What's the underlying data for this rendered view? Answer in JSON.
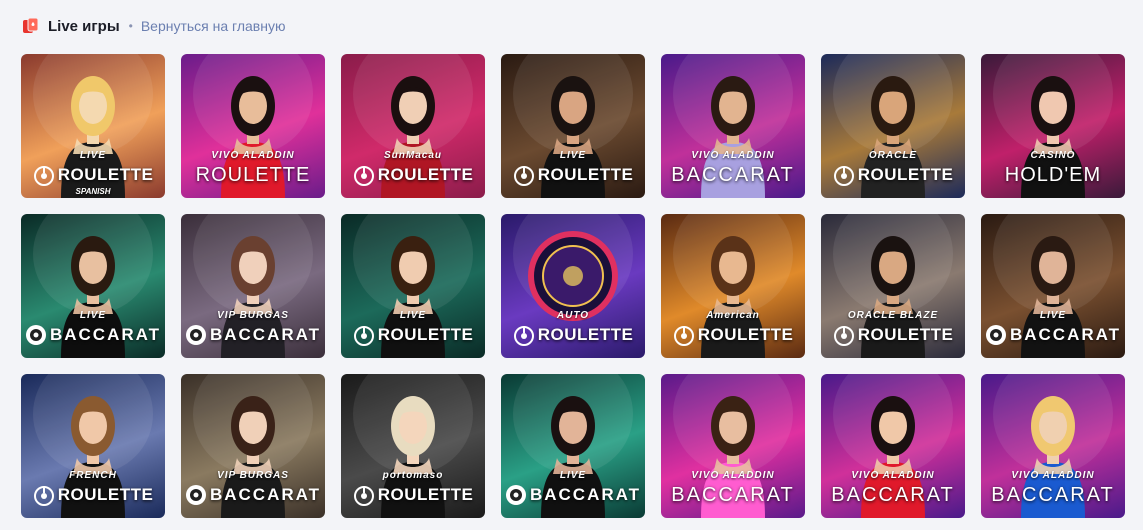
{
  "header": {
    "title": "Live игры",
    "separator": "•",
    "back_link": "Вернуться на главную",
    "icon": "cards-icon",
    "accent": "#e8342e"
  },
  "games": [
    {
      "tag": "LIVE",
      "name": "ROULETTE",
      "sub": "SPANISH",
      "chip": "roulette",
      "bg": [
        "#8a3a2e",
        "#f0a05a"
      ],
      "skin": "#f4d9b0",
      "hair": "#f0c86a",
      "outfit": "#1a1a1a"
    },
    {
      "tag": "VIVO ALADDIN",
      "name": "ROULETTE",
      "sub": "",
      "chip": "none",
      "bg": [
        "#6a1c8a",
        "#e0309a"
      ],
      "skin": "#e8bd9a",
      "hair": "#1a1010",
      "outfit": "#e0192b"
    },
    {
      "tag": "SunMacau",
      "name": "ROULETTE",
      "sub": "",
      "chip": "roulette",
      "bg": [
        "#8a1c4a",
        "#d02a6a"
      ],
      "skin": "#f0cfb5",
      "hair": "#1a0f0f",
      "outfit": "#b01624"
    },
    {
      "tag": "LIVE",
      "name": "ROULETTE",
      "sub": "",
      "chip": "roulette",
      "bg": [
        "#2a1a12",
        "#6b4a30"
      ],
      "skin": "#d9a582",
      "hair": "#1a1210",
      "outfit": "#111111"
    },
    {
      "tag": "VIVO ALADDIN",
      "name": "BACCARAT",
      "sub": "",
      "chip": "none",
      "bg": [
        "#4a1a8a",
        "#c0309a"
      ],
      "skin": "#e2b490",
      "hair": "#2a1a12",
      "outfit": "#a8a0e0"
    },
    {
      "tag": "ORACLE",
      "name": "ROULETTE",
      "sub": "",
      "chip": "roulette",
      "bg": [
        "#1c2a5a",
        "#a87a3a"
      ],
      "skin": "#d9a57a",
      "hair": "#2a1a10",
      "outfit": "#222222"
    },
    {
      "tag": "CASINO",
      "name": "HOLD'EM",
      "sub": "",
      "chip": "none",
      "bg": [
        "#3a1a3a",
        "#c0206a"
      ],
      "skin": "#f0c8b0",
      "hair": "#1a1010",
      "outfit": "#111111"
    },
    {
      "tag": "LIVE",
      "name": "BACCARAT",
      "sub": "",
      "chip": "baccarat",
      "bg": [
        "#0a2a26",
        "#2a8a70"
      ],
      "skin": "#e8c0a0",
      "hair": "#2a1a10",
      "outfit": "#0d0d0d"
    },
    {
      "tag": "VIP BURGAS",
      "name": "BACCARAT",
      "sub": "",
      "chip": "baccarat",
      "bg": [
        "#3a2e3a",
        "#7a6a80"
      ],
      "skin": "#f0d0bb",
      "hair": "#6a4030",
      "outfit": "#222026"
    },
    {
      "tag": "LIVE",
      "name": "ROULETTE",
      "sub": "",
      "chip": "roulette",
      "bg": [
        "#0a2a26",
        "#1c6a5a"
      ],
      "skin": "#f0ccb0",
      "hair": "#3a2010",
      "outfit": "#101010"
    },
    {
      "tag": "AUTO",
      "name": "ROULETTE",
      "sub": "",
      "chip": "roulette",
      "bg": [
        "#2a1a6a",
        "#6a3ac0"
      ],
      "skin": "",
      "hair": "",
      "outfit": ""
    },
    {
      "tag": "American",
      "name": "ROULETTE",
      "sub": "",
      "chip": "roulette",
      "bg": [
        "#5a2a12",
        "#e08a2a"
      ],
      "skin": "#e8b890",
      "hair": "#5a3218",
      "outfit": "#1a1a1a"
    },
    {
      "tag": "ORACLE BLAZE",
      "name": "ROULETTE",
      "sub": "",
      "chip": "roulette",
      "bg": [
        "#2a2a3a",
        "#8a7a70"
      ],
      "skin": "#d9a882",
      "hair": "#1a1210",
      "outfit": "#1a1a1a"
    },
    {
      "tag": "LIVE",
      "name": "BACCARAT",
      "sub": "",
      "chip": "baccarat",
      "bg": [
        "#2a1a12",
        "#7a5030"
      ],
      "skin": "#e0b498",
      "hair": "#2a1a12",
      "outfit": "#121212"
    },
    {
      "tag": "FRENCH",
      "name": "ROULETTE",
      "sub": "",
      "chip": "roulette",
      "bg": [
        "#1a2a5a",
        "#6a7ab0"
      ],
      "skin": "#f0c8a8",
      "hair": "#8a5a30",
      "outfit": "#111111"
    },
    {
      "tag": "VIP BURGAS",
      "name": "BACCARAT",
      "sub": "",
      "chip": "baccarat",
      "bg": [
        "#3a3028",
        "#8a7a60"
      ],
      "skin": "#f0d0b8",
      "hair": "#3a2218",
      "outfit": "#1a1a1a"
    },
    {
      "tag": "portomaso",
      "name": "ROULETTE",
      "sub": "",
      "chip": "roulette",
      "bg": [
        "#1a1a1a",
        "#4a4a4a"
      ],
      "skin": "#f4d6bc",
      "hair": "#e8dcc0",
      "outfit": "#111111"
    },
    {
      "tag": "LIVE",
      "name": "BACCARAT",
      "sub": "",
      "chip": "baccarat",
      "bg": [
        "#0a3a34",
        "#2aa086"
      ],
      "skin": "#e2b498",
      "hair": "#1a1010",
      "outfit": "#101010"
    },
    {
      "tag": "VIVO ALADDIN",
      "name": "BACCARAT",
      "sub": "",
      "chip": "none",
      "bg": [
        "#5a1a8a",
        "#e030a0"
      ],
      "skin": "#e8bea0",
      "hair": "#3a2214",
      "outfit": "#ff5cd0"
    },
    {
      "tag": "VIVO ALADDIN",
      "name": "BACCARAT",
      "sub": "",
      "chip": "none",
      "bg": [
        "#4a1a8a",
        "#d0309a"
      ],
      "skin": "#f0c8a8",
      "hair": "#1a1010",
      "outfit": "#e0192b"
    },
    {
      "tag": "VIVO ALADDIN",
      "name": "BACCARAT",
      "sub": "",
      "chip": "none",
      "bg": [
        "#4a1a8a",
        "#c0309a"
      ],
      "skin": "#f0d0b0",
      "hair": "#f0c870",
      "outfit": "#1a5ad0"
    }
  ]
}
